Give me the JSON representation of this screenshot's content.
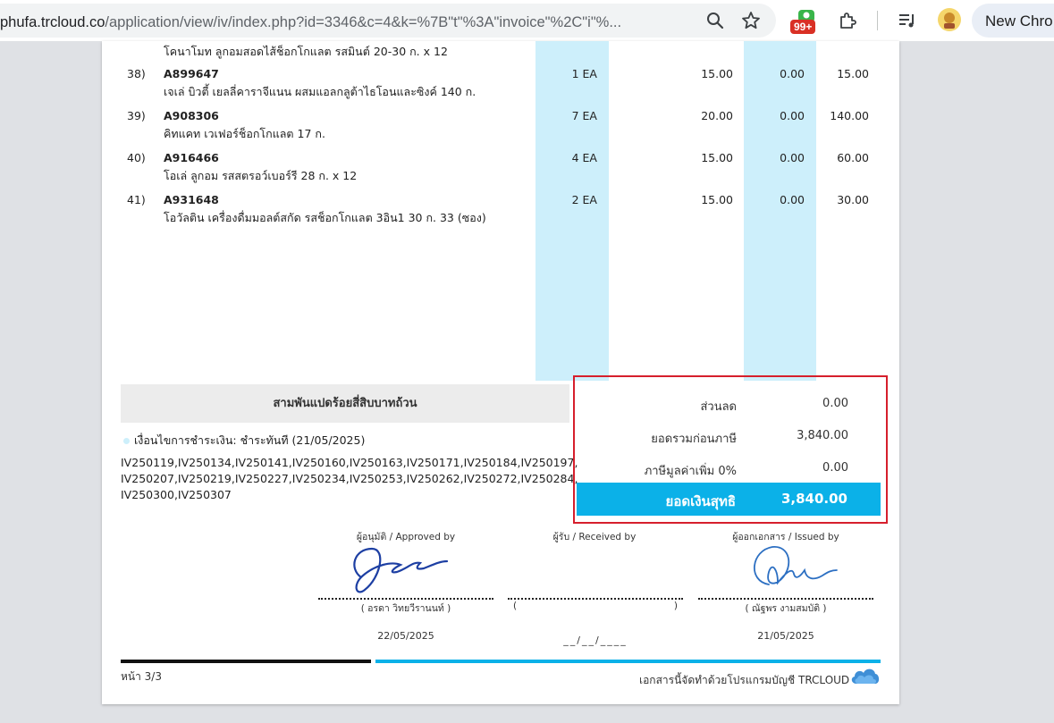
{
  "browser": {
    "url_host": "phufa.trcloud.co",
    "url_path": "/application/view/iv/index.php?id=3346&c=4&k=%7B\"t\"%3A\"invoice\"%2C\"i\"%...",
    "extension_badge": "99+",
    "profile_label": "New Chro"
  },
  "items": [
    {
      "desc_partial": "โคนาโมท ลูกอมสอดไส้ช็อกโกแลต รสมินต์ 20-30 ก. x 12"
    },
    {
      "no": "38)",
      "code": "A899647",
      "desc": "เจเล่ บิวตี้ เยลลี่คาราจีแนน ผสมแอลกลูต้าไธโอนและซิงค์ 140 ก.",
      "qty": "1 EA",
      "price": "15.00",
      "discount": "0.00",
      "amount": "15.00"
    },
    {
      "no": "39)",
      "code": "A908306",
      "desc": "คิทแคท เวเฟอร์ช็อกโกแลต 17 ก.",
      "qty": "7 EA",
      "price": "20.00",
      "discount": "0.00",
      "amount": "140.00"
    },
    {
      "no": "40)",
      "code": "A916466",
      "desc": "โอเล่ ลูกอม รสสตรอว์เบอร์รี 28 ก. x 12",
      "qty": "4 EA",
      "price": "15.00",
      "discount": "0.00",
      "amount": "60.00"
    },
    {
      "no": "41)",
      "code": "A931648",
      "desc": "โอวัลติน เครื่องดื่มมอลต์สกัด รสช็อกโกแลต 3อิน1 30 ก. 33 (ซอง)",
      "qty": "2 EA",
      "price": "15.00",
      "discount": "0.00",
      "amount": "30.00"
    }
  ],
  "amount_in_words": "สามพันแปดร้อยสี่สิบบาทถ้วน",
  "payment_condition": "เงื่อนไขการชำระเงิน: ชำระทันที (21/05/2025)",
  "references": "IV250119,IV250134,IV250141,IV250160,IV250163,IV250171,IV250184,IV250197, IV250207,IV250219,IV250227,IV250234,IV250253,IV250262,IV250272,IV250284, IV250300,IV250307",
  "summary": {
    "discount_label": "ส่วนลด",
    "discount_value": "0.00",
    "pretax_label": "ยอดรวมก่อนภาษี",
    "pretax_value": "3,840.00",
    "vat_label": "ภาษีมูลค่าเพิ่ม 0%",
    "vat_value": "0.00",
    "net_label": "ยอดเงินสุทธิ",
    "net_value": "3,840.00"
  },
  "signatures": {
    "approved_label": "ผู้อนุมัติ / Approved by",
    "approved_name": "( อรดา วิทยวีรานนท์ )",
    "approved_date": "22/05/2025",
    "received_label": "ผู้รับ / Received by",
    "received_name_open": "(",
    "received_name_close": ")",
    "received_date": "__/__/____",
    "issued_label": "ผู้ออกเอกสาร / Issued by",
    "issued_name": "( ณัฐพร งามสมบัติ )",
    "issued_date": "21/05/2025"
  },
  "footer": {
    "page": "หน้า 3/3",
    "powered_by": "เอกสารนี้จัดทำด้วยโปรแกรมบัญชี TRCLOUD"
  },
  "colors": {
    "accent": "#0bb1e8",
    "column_highlight": "#cdeffb",
    "highlight_border": "#d61f2c"
  },
  "icons": [
    "search-icon",
    "star-icon",
    "extension-badge-icon",
    "puzzle-icon",
    "media-control-icon",
    "profile-avatar-icon",
    "trcloud-cloud-icon"
  ]
}
